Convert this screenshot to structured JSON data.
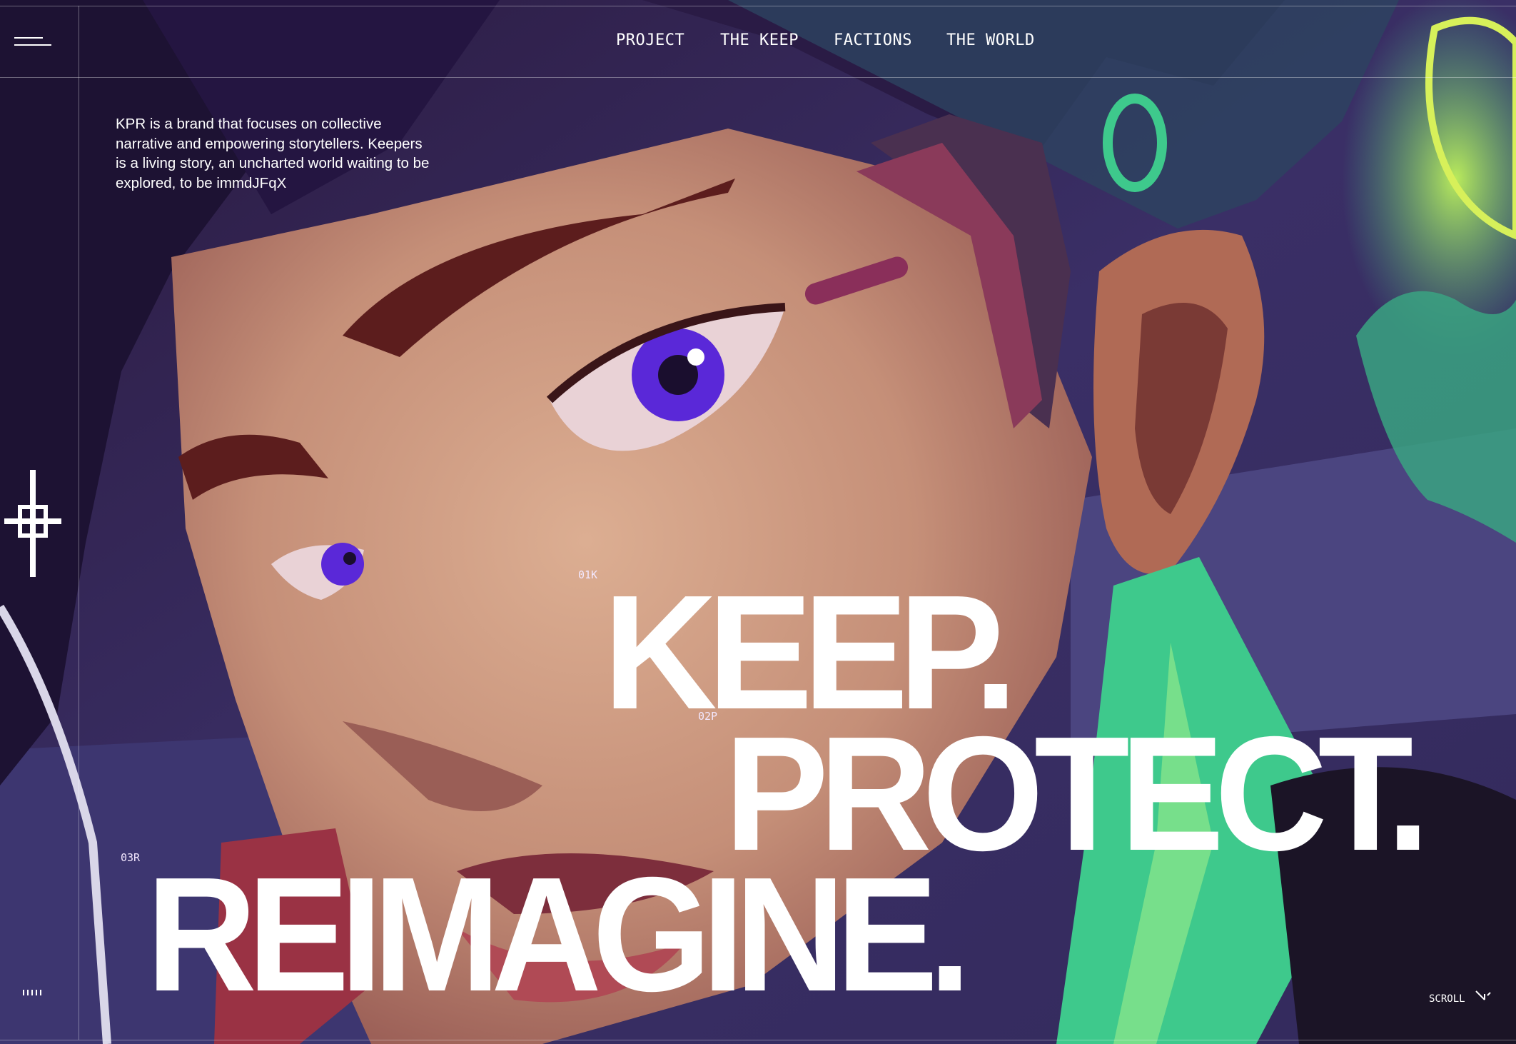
{
  "nav": {
    "links": [
      "PROJECT",
      "THE KEEP",
      "FACTIONS",
      "THE WORLD"
    ]
  },
  "intro": {
    "text": "KPR is a brand that focuses on collective narrative and empowering storytellers. Keepers is a living story, an uncharted world waiting to be explored, to be immdJFqX"
  },
  "hero": {
    "line1": {
      "code": "01K",
      "word": "KEEP."
    },
    "line2": {
      "code": "02P",
      "word": "PROTECT."
    },
    "line3": {
      "code": "03R",
      "word": "REIMAGINE."
    }
  },
  "scroll": {
    "label": "SCROLL"
  },
  "icons": {
    "menu": "hamburger-menu-icon",
    "crosshair": "crosshair-icon",
    "scroll": "scroll-indicator-icon",
    "ticks": "tick-marks-icon"
  },
  "colors": {
    "background": "#2a1d4a",
    "text": "#ffffff",
    "accent_green": "#3ec98c"
  }
}
